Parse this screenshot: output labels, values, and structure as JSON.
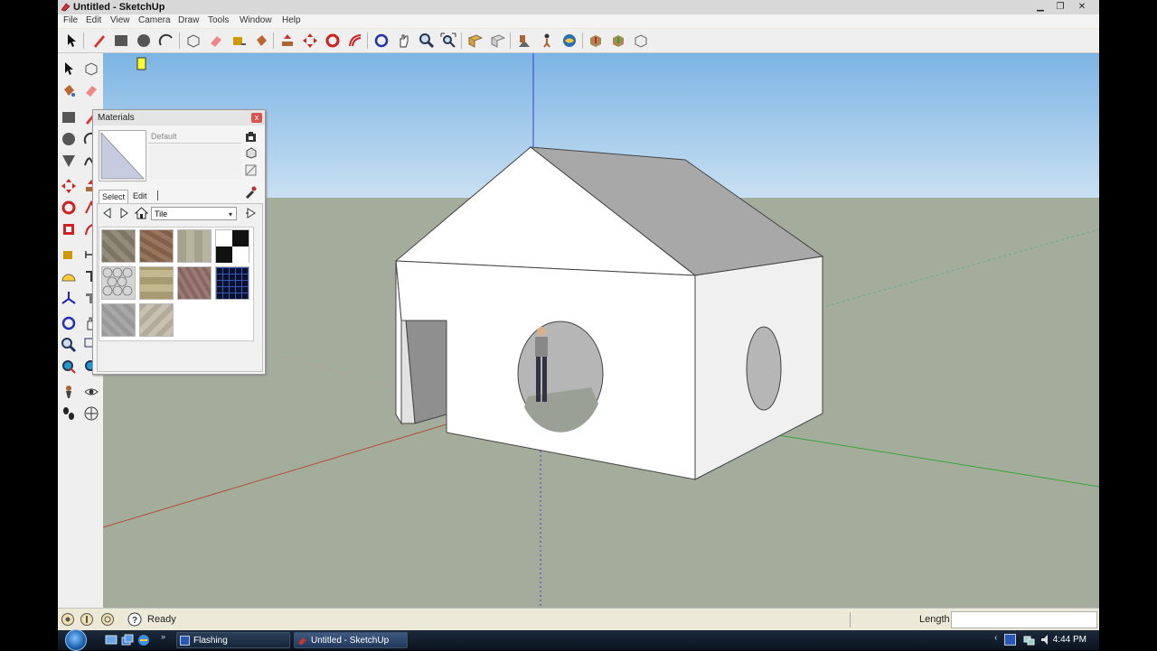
{
  "window": {
    "title": "Untitled - SketchUp",
    "controls": {
      "minimize": "▁",
      "restore": "❐",
      "close": "✕"
    }
  },
  "menu": [
    "File",
    "Edit",
    "View",
    "Camera",
    "Draw",
    "Tools",
    "Window",
    "Help"
  ],
  "toolbar": {
    "icons": [
      "select-icon",
      "pencil-icon",
      "rectangle-icon",
      "circle-icon",
      "arc-icon",
      "make-component-icon",
      "eraser-icon",
      "tape-measure-icon",
      "paint-bucket-icon",
      "push-pull-icon",
      "move-icon",
      "rotate-icon",
      "offset-icon",
      "orbit-icon",
      "pan-icon",
      "zoom-icon",
      "zoom-extents-icon",
      "previous-view-icon",
      "next-view-icon",
      "position-camera-icon",
      "walk-icon",
      "look-around-icon",
      "get-models-icon",
      "share-model-icon",
      "components-icon"
    ]
  },
  "left_toolbar": {
    "icons": [
      "select-icon",
      "make-component-icon",
      "paint-bucket-icon",
      "eraser-icon",
      "rectangle-icon",
      "line-icon",
      "circle-icon",
      "arc-icon",
      "polygon-icon",
      "freehand-icon",
      "move-icon",
      "push-pull-icon",
      "rotate-icon",
      "follow-me-icon",
      "scale-icon",
      "offset-icon",
      "tape-measure-icon",
      "dimension-icon",
      "protractor-icon",
      "text-icon",
      "axes-icon",
      "3d-text-icon",
      "orbit-icon",
      "pan-icon",
      "zoom-icon",
      "zoom-window-icon",
      "zoom-extents-icon",
      "previous-icon",
      "position-camera-icon",
      "look-around-icon",
      "walk-icon",
      "section-plane-icon"
    ]
  },
  "materials_dialog": {
    "title": "Materials",
    "close": "x",
    "material_name": "Default",
    "tabs": [
      "Select",
      "Edit"
    ],
    "library": "Tile",
    "swatches": [
      "#8b8272",
      "#8a6a52",
      "#a8a68e",
      "checker",
      "hexagon",
      "#a89a72",
      "#8a6a60",
      "blue-grid",
      "#9c9c9c",
      "#b8b0a0"
    ]
  },
  "statusbar": {
    "status": "Ready",
    "length_label": "Length",
    "length_value": ""
  },
  "taskbar": {
    "tasks": [
      "Flashing",
      "Untitled - SketchUp"
    ],
    "clock": "4:44 PM"
  },
  "colors": {
    "sky": "#7fb7e6",
    "ground": "#a4ad9b",
    "roof_shadow": "#a8a8a8",
    "wall_light": "#ffffff",
    "wall_side": "#f0f0f0",
    "red_axis": "#b44d3a",
    "green_axis": "#3aa43a",
    "blue_axis": "#3a3ad8"
  }
}
